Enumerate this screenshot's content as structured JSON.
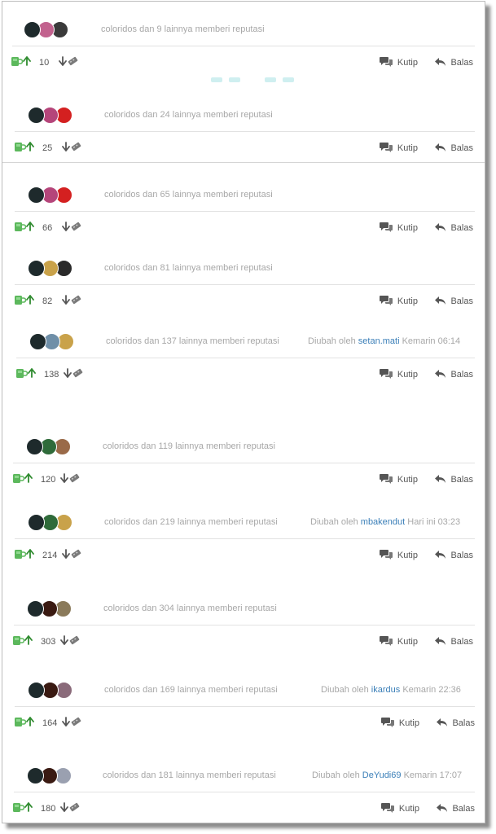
{
  "labels": {
    "quote": "Kutip",
    "reply": "Balas",
    "edited_by": "Diubah oleh"
  },
  "icons": {
    "cendol": "green-mug-icon",
    "up": "arrow-up-icon",
    "down": "arrow-down-icon",
    "bata": "brick-icon",
    "quote": "speech-bubbles-icon",
    "reply": "reply-arrow-icon"
  },
  "colors": {
    "cendol": "#5cb85c",
    "link": "#3b7fb8",
    "muted": "#a7a7a7"
  },
  "posts": [
    {
      "reputation": "coloridos dan 9 lainnya memberi reputasi",
      "count": "10",
      "avatars": [
        "#1e2a2c",
        "#c2628e",
        "#3a3a3a"
      ]
    },
    {
      "reputation": "coloridos dan 24 lainnya memberi reputasi",
      "count": "25",
      "avatars": [
        "#1e2a2c",
        "#b5457a",
        "#d42020"
      ]
    },
    {
      "reputation": "coloridos dan 65 lainnya memberi reputasi",
      "count": "66",
      "avatars": [
        "#1e2a2c",
        "#b5457a",
        "#d42020"
      ]
    },
    {
      "reputation": "coloridos dan 81 lainnya memberi reputasi",
      "count": "82",
      "avatars": [
        "#1e2a2c",
        "#c9a24a",
        "#2a2a2a"
      ]
    },
    {
      "reputation": "coloridos dan 137 lainnya memberi reputasi",
      "count": "138",
      "avatars": [
        "#1e2a2c",
        "#6f8fa8",
        "#c9a24a"
      ],
      "edited": {
        "user": "setan.mati",
        "time": "Kemarin 06:14"
      }
    },
    {
      "reputation": "coloridos dan 119 lainnya memberi reputasi",
      "count": "120",
      "avatars": [
        "#1e2a2c",
        "#2f6b3a",
        "#9a6a48"
      ]
    },
    {
      "reputation": "coloridos dan 219 lainnya memberi reputasi",
      "count": "214",
      "avatars": [
        "#1e2a2c",
        "#2f6b3a",
        "#c9a24a"
      ],
      "edited": {
        "user": "mbakendut",
        "time": "Hari ini 03:23"
      }
    },
    {
      "reputation": "coloridos dan 304 lainnya memberi reputasi",
      "count": "303",
      "avatars": [
        "#1e2a2c",
        "#3a1a12",
        "#8a7a5a"
      ]
    },
    {
      "reputation": "coloridos dan 169 lainnya memberi reputasi",
      "count": "164",
      "avatars": [
        "#1e2a2c",
        "#3a1a12",
        "#8a6a7a"
      ],
      "edited": {
        "user": "ikardus",
        "time": "Kemarin 22:36"
      }
    },
    {
      "reputation": "coloridos dan 181 lainnya memberi reputasi",
      "count": "180",
      "avatars": [
        "#1e2a2c",
        "#3a1a12",
        "#9aa0b0"
      ],
      "edited": {
        "user": "DeYudi69",
        "time": "Kemarin 17:07"
      }
    }
  ]
}
